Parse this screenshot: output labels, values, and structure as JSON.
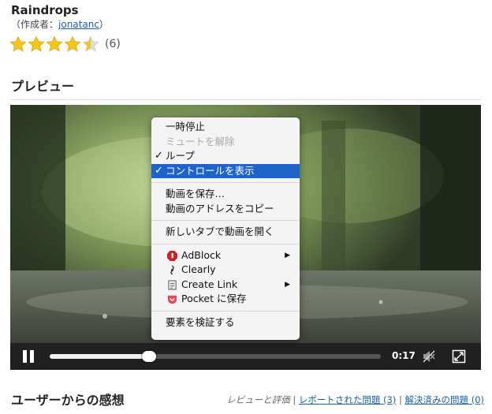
{
  "extension": {
    "title": "Raindrops",
    "author_prefix": "（作成者：",
    "author_name": "jonatanc",
    "author_suffix": "）",
    "rating_stars": 4.5,
    "rating_max": 5,
    "rating_count": "(6)"
  },
  "preview": {
    "heading": "プレビュー"
  },
  "video": {
    "time": "0:17",
    "progress_fraction": 0.3,
    "icons": [
      "pause-icon",
      "volume-muted-icon",
      "fullscreen-icon"
    ]
  },
  "context_menu": {
    "items": [
      {
        "label": "一時停止"
      },
      {
        "label": "ミュートを解除"
      },
      {
        "label": "ループ"
      },
      {
        "label": "コントロールを表示"
      },
      {
        "label": "動画を保存…"
      },
      {
        "label": "動画のアドレスをコピー"
      },
      {
        "label": "新しいタブで動画を開く"
      },
      {
        "label": "AdBlock"
      },
      {
        "label": "Clearly"
      },
      {
        "label": "Create Link"
      },
      {
        "label": "Pocket に保存"
      },
      {
        "label": "要素を検証する"
      }
    ]
  },
  "feedback": {
    "heading": "ユーザーからの感想",
    "reviews_label": "レビューと評価",
    "reported_link": "レポートされた問題 (3)",
    "resolved_link": "解決済みの問題 (0)",
    "separator": "|"
  },
  "colors": {
    "link": "#1a5fb4",
    "star": "#f5c518",
    "menu_highlight": "#1e63c8"
  }
}
